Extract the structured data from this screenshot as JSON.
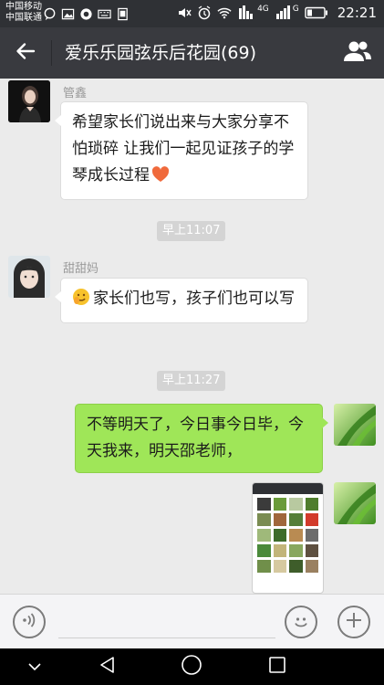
{
  "status_bar": {
    "carrier_1": "中国移动",
    "carrier_2": "中国联通",
    "time": "22:21",
    "network_1": "4G",
    "network_2": "G"
  },
  "header": {
    "title": "爱乐乐园弦乐后花园(69)"
  },
  "messages": [
    {
      "sender": "管鑫",
      "text": "希望家长们说出来与大家分享不怕琐碎 让我们一起见证孩子的学琴成长过程"
    },
    {
      "time": "早上11:07"
    },
    {
      "sender": "甜甜妈",
      "text": "家长们也写，孩子们也可以写"
    },
    {
      "time": "早上11:27"
    },
    {
      "text": "不等明天了，今日事今日毕，今天我来，明天邵老师，",
      "outgoing": true
    },
    {
      "image": true,
      "outgoing": true
    }
  ],
  "input_bar": {
    "placeholder": ""
  },
  "colors": {
    "title_bar": "#393a3f",
    "status_bar": "#2f3135",
    "outgoing_bubble": "#9fe658",
    "chat_bg": "#ebebeb"
  },
  "icons": {
    "back": "arrow-left-icon",
    "members": "group-members-icon",
    "voice": "voice-icon",
    "emoji": "emoji-icon",
    "plus": "plus-icon",
    "heart": "heart-icon",
    "face_emoji": "smiling-face-icon"
  }
}
